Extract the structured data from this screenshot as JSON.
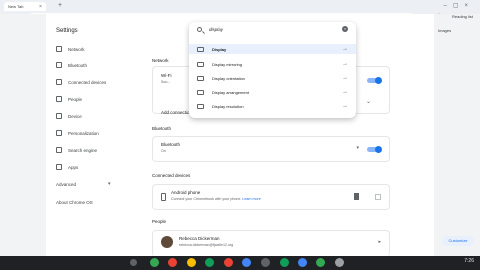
{
  "browser": {
    "tab_title": "New Tab",
    "address": "fjwalle12.org/ipal",
    "bookmark_right_1": "Images",
    "bookmark_right_2": "Reading list"
  },
  "settings": {
    "title": "Settings",
    "sidebar": [
      {
        "label": "Network"
      },
      {
        "label": "Bluetooth"
      },
      {
        "label": "Connected devices"
      },
      {
        "label": "People"
      },
      {
        "label": "Device"
      },
      {
        "label": "Personalization"
      },
      {
        "label": "Search engine"
      },
      {
        "label": "Apps"
      },
      {
        "label": "Advanced"
      },
      {
        "label": "About Chrome OS"
      }
    ],
    "network": {
      "section_title": "Network",
      "wifi_label": "Wi-Fi",
      "wifi_sub": "Sou...",
      "add_connection": "Add connection"
    },
    "bluetooth": {
      "section_title": "Bluetooth",
      "label": "Bluetooth",
      "sub": "On"
    },
    "connected": {
      "section_title": "Connected devices",
      "label": "Android phone",
      "sub": "Connect your Chromebook with your phone.",
      "learn_more": "Learn more"
    },
    "people": {
      "section_title": "People",
      "name": "Rebecca Dickerman",
      "email": "rebecca.dickerman@fjwalle12.org"
    }
  },
  "search": {
    "query": "display",
    "results": [
      {
        "label": "Display",
        "selected": true
      },
      {
        "label": "Display mirroring",
        "selected": false
      },
      {
        "label": "Display orientation",
        "selected": false
      },
      {
        "label": "Display arrangement",
        "selected": false
      },
      {
        "label": "Display resolution",
        "selected": false
      }
    ]
  },
  "customize_label": "Customize",
  "tray": {
    "time": "7:26"
  }
}
